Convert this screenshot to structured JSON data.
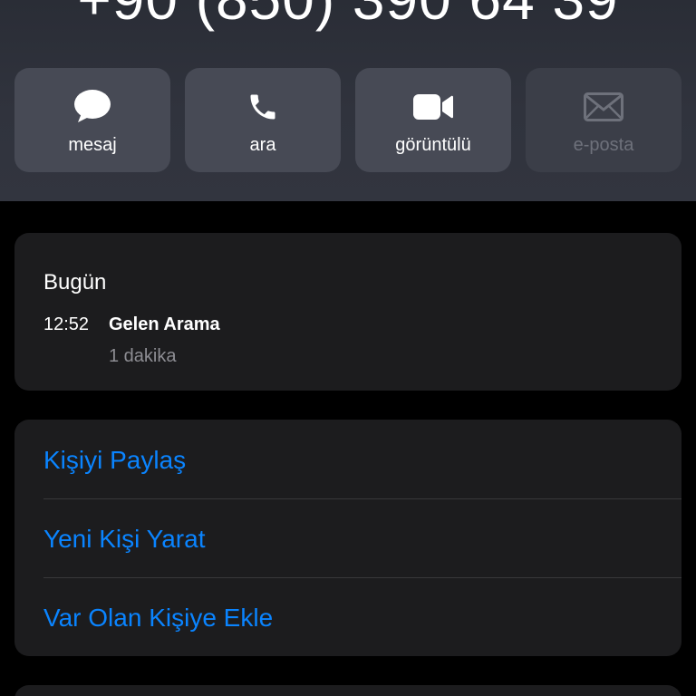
{
  "contact": {
    "phone_number": "+90 (850) 390 64 39"
  },
  "actions": [
    {
      "label": "mesaj",
      "icon": "message-bubble-icon",
      "enabled": true
    },
    {
      "label": "ara",
      "icon": "phone-icon",
      "enabled": true
    },
    {
      "label": "görüntülü",
      "icon": "video-camera-icon",
      "enabled": true
    },
    {
      "label": "e-posta",
      "icon": "mail-envelope-icon",
      "enabled": false
    }
  ],
  "recent_calls": {
    "day": "Bugün",
    "calls": [
      {
        "time": "12:52",
        "type": "Gelen Arama",
        "duration": "1 dakika"
      }
    ]
  },
  "options": [
    {
      "label": "Kişiyi Paylaş"
    },
    {
      "label": "Yeni Kişi Yarat"
    },
    {
      "label": "Var Olan Kişiye Ekle"
    }
  ],
  "colors": {
    "accent": "#0a84ff",
    "background": "#000000",
    "card": "#1c1c1e",
    "action_button": "#474a55",
    "secondary_text": "#8d8d93"
  }
}
